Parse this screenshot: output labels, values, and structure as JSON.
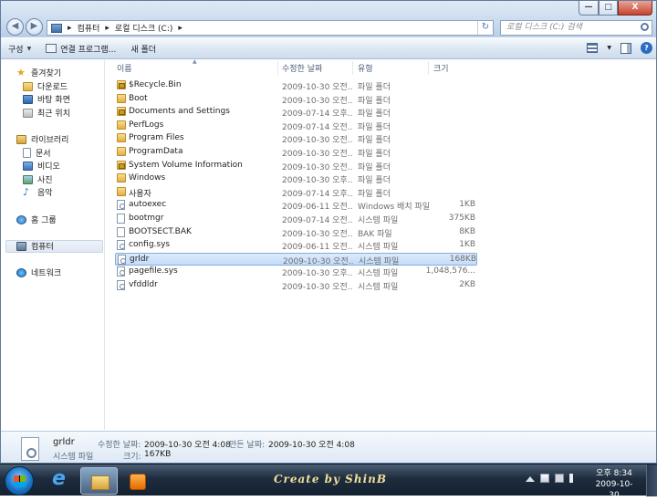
{
  "window": {
    "minimize_glyph": "—",
    "maximize_glyph": "□",
    "close_glyph": "X"
  },
  "address": {
    "back_glyph": "◀",
    "forward_glyph": "▶",
    "crumbs": [
      "컴퓨터",
      "로컬 디스크 (C:)"
    ],
    "separator": "▸",
    "refresh_glyph": "↻"
  },
  "search": {
    "placeholder": "로컬 디스크 (C:) 검색"
  },
  "toolbar": {
    "organize": "구성",
    "open_with": "연결 프로그램...",
    "new_folder": "새 폴더",
    "dropdown_glyph": "▼",
    "help_glyph": "?"
  },
  "sidebar": {
    "favorites": {
      "label": "즐겨찾기",
      "items": [
        "다운로드",
        "바탕 화면",
        "최근 위치"
      ]
    },
    "libraries": {
      "label": "라이브러리",
      "items": [
        "문서",
        "비디오",
        "사진",
        "음악"
      ]
    },
    "homegroup": "홈 그룹",
    "computer": "컴퓨터",
    "network": "네트워크"
  },
  "columns": {
    "name": "이름",
    "date": "수정한 날짜",
    "type": "유형",
    "size": "크기"
  },
  "files": [
    {
      "name": "$Recycle.Bin",
      "date": "2009-10-30 오전...",
      "type": "파일 폴더",
      "size": "",
      "icon": "locked-folder"
    },
    {
      "name": "Boot",
      "date": "2009-10-30 오전...",
      "type": "파일 폴더",
      "size": "",
      "icon": "folder"
    },
    {
      "name": "Documents and Settings",
      "date": "2009-07-14 오후...",
      "type": "파일 폴더",
      "size": "",
      "icon": "locked-folder"
    },
    {
      "name": "PerfLogs",
      "date": "2009-07-14 오전...",
      "type": "파일 폴더",
      "size": "",
      "icon": "folder"
    },
    {
      "name": "Program Files",
      "date": "2009-10-30 오전...",
      "type": "파일 폴더",
      "size": "",
      "icon": "folder"
    },
    {
      "name": "ProgramData",
      "date": "2009-10-30 오전...",
      "type": "파일 폴더",
      "size": "",
      "icon": "folder"
    },
    {
      "name": "System Volume Information",
      "date": "2009-10-30 오전...",
      "type": "파일 폴더",
      "size": "",
      "icon": "locked-folder"
    },
    {
      "name": "Windows",
      "date": "2009-10-30 오후...",
      "type": "파일 폴더",
      "size": "",
      "icon": "folder"
    },
    {
      "name": "사용자",
      "date": "2009-07-14 오후...",
      "type": "파일 폴더",
      "size": "",
      "icon": "folder"
    },
    {
      "name": "autoexec",
      "date": "2009-06-11 오전...",
      "type": "Windows 배치 파일",
      "size": "1KB",
      "icon": "gear-file"
    },
    {
      "name": "bootmgr",
      "date": "2009-07-14 오전...",
      "type": "시스템 파일",
      "size": "375KB",
      "icon": "file"
    },
    {
      "name": "BOOTSECT.BAK",
      "date": "2009-10-30 오전...",
      "type": "BAK 파일",
      "size": "8KB",
      "icon": "file"
    },
    {
      "name": "config.sys",
      "date": "2009-06-11 오전...",
      "type": "시스템 파일",
      "size": "1KB",
      "icon": "gear-file"
    },
    {
      "name": "grldr",
      "date": "2009-10-30 오전...",
      "type": "시스템 파일",
      "size": "168KB",
      "icon": "gear-file",
      "selected": true
    },
    {
      "name": "pagefile.sys",
      "date": "2009-10-30 오후...",
      "type": "시스템 파일",
      "size": "1,048,576...",
      "icon": "gear-file"
    },
    {
      "name": "vfddldr",
      "date": "2009-10-30 오전...",
      "type": "시스템 파일",
      "size": "2KB",
      "icon": "gear-file"
    }
  ],
  "details": {
    "name": "grldr",
    "type": "시스템 파일",
    "modified_label": "수정한 날짜:",
    "modified_value": "2009-10-30 오전 4:08",
    "created_label": "만든 날짜:",
    "created_value": "2009-10-30 오전 4:08",
    "size_label": "크기:",
    "size_value": "167KB"
  },
  "taskbar": {
    "credit": "Create by ShinB",
    "time": "오후 8:34",
    "date": "2009-10-30"
  }
}
